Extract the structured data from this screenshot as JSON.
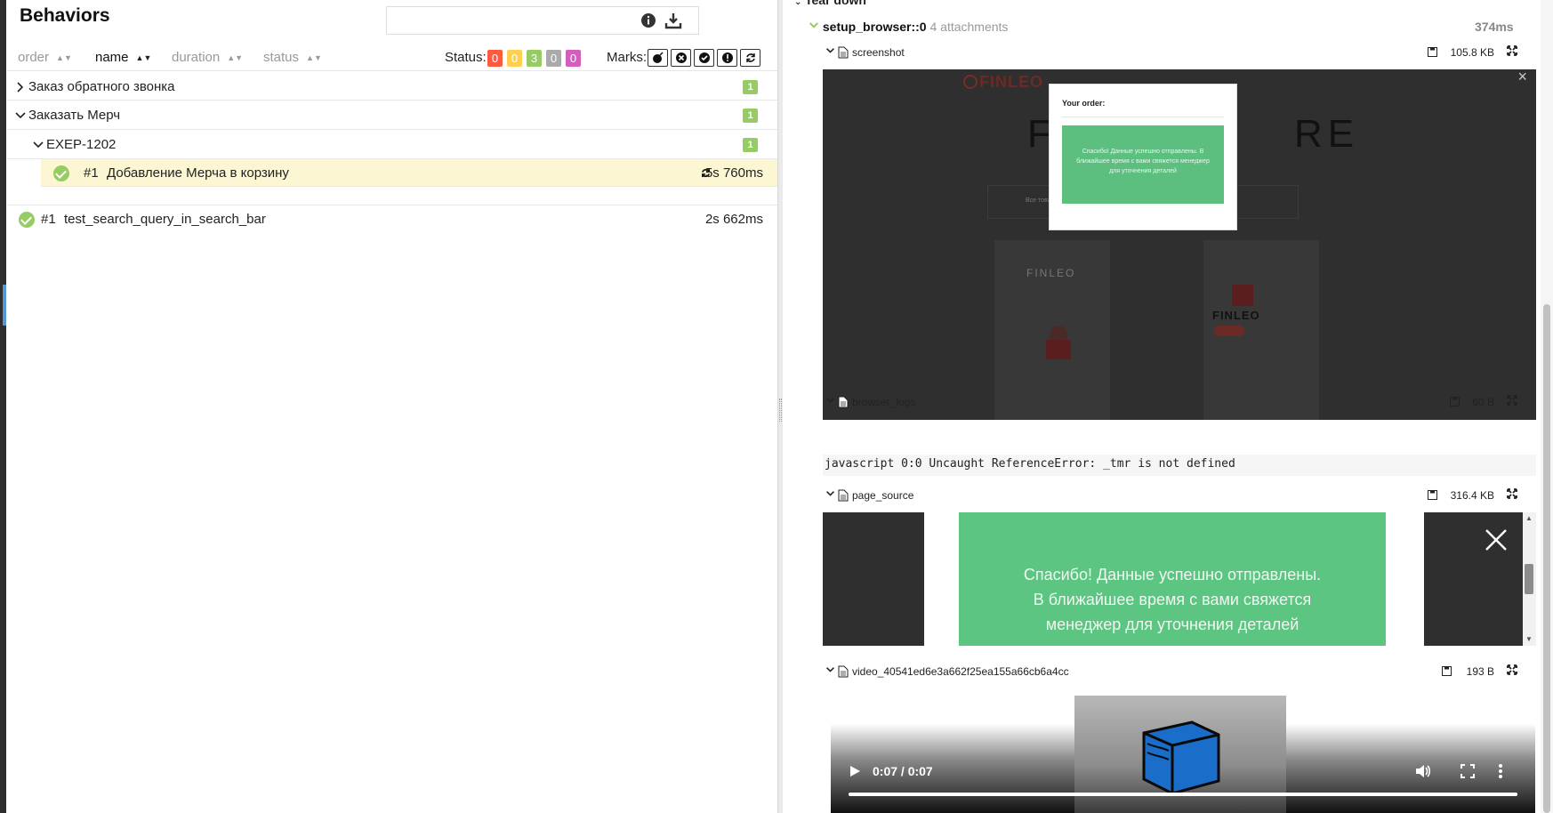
{
  "left": {
    "title": "Behaviors",
    "search": {
      "value": "",
      "placeholder": ""
    },
    "sort": {
      "order": "order",
      "name": "name",
      "duration": "duration",
      "status": "status"
    },
    "status_label": "Status:",
    "status_badges": [
      {
        "value": "0",
        "color": "#fd5a3e"
      },
      {
        "value": "0",
        "color": "#ffd050"
      },
      {
        "value": "3",
        "color": "#97cc64"
      },
      {
        "value": "0",
        "color": "#aaaaaa"
      },
      {
        "value": "0",
        "color": "#d35ebe"
      }
    ],
    "marks_label": "Marks:",
    "marks": [
      "bomb-icon",
      "close-circle-icon",
      "check-circle-icon",
      "info-circle-icon",
      "retry-icon"
    ],
    "groups": [
      {
        "label": "Заказ обратного звонка",
        "count": "1"
      },
      {
        "label": "Заказать Мерч",
        "count": "1"
      },
      {
        "label": "EXEP-1202",
        "count": "1"
      }
    ],
    "tests": [
      {
        "num": "#1",
        "name": "Добавление Мерча в корзину",
        "duration": "5s 760ms"
      },
      {
        "num": "#1",
        "name": "test_search_query_in_search_bar",
        "duration": "2s 662ms"
      }
    ]
  },
  "right": {
    "teardown": "Tear down",
    "setup": {
      "name": "setup_browser::0",
      "attachments": "4 attachments",
      "time": "374ms"
    },
    "attachments": [
      {
        "name": "screenshot",
        "size": "105.8 KB"
      },
      {
        "name": "browser_logs",
        "size": "60 B"
      },
      {
        "name": "page_source",
        "size": "316.4 KB"
      },
      {
        "name": "video_40541ed6e3a662f25ea155a66cb6a4cc",
        "size": "193 B"
      }
    ],
    "console_text": "javascript 0:0 Uncaught ReferenceError: _tmr is not defined",
    "screenshot": {
      "logo": "FINLEO",
      "modal_title": "Your order:",
      "modal_msg": "Спасибо! Данные успешно отправлены. В ближайшее время с вами свяжется менеджер для уточнения деталей",
      "bg_big_left": "FIN",
      "bg_big_right": "RE",
      "tab_left": "Все товары",
      "product_brand": "FINLEO"
    },
    "page_source": {
      "line1": "Спасибо! Данные успешно отправлены.",
      "line2": "В ближайшее время с вами свяжется",
      "line3": "менеджер для уточнения деталей"
    },
    "video": {
      "time": "0:07 / 0:07",
      "progress": 1.0
    }
  }
}
